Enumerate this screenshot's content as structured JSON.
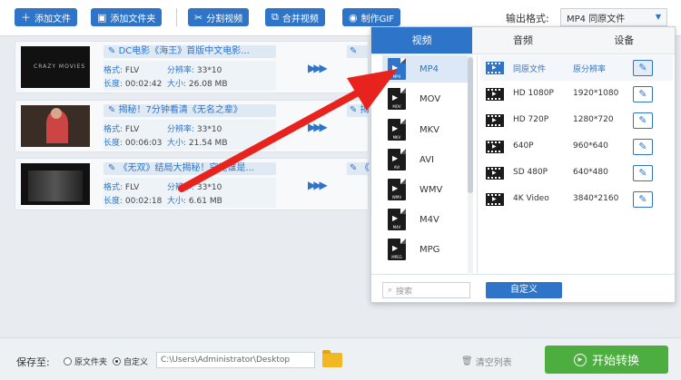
{
  "toolbar": {
    "add_file": "添加文件",
    "add_folder": "添加文件夹",
    "split_video": "分割视频",
    "merge_video": "合并视频",
    "make_gif": "制作GIF",
    "output_format_label": "输出格式:",
    "output_format_value": "MP4 同原文件"
  },
  "files": [
    {
      "title": "DC电影《海王》首版中文电影...",
      "format_label": "格式:",
      "format": "FLV",
      "resolution_label": "分辨率:",
      "resolution": "33*10",
      "duration_label": "长度:",
      "duration": "00:02:42",
      "size_label": "大小:",
      "size": "26.08 MB",
      "out_tag": "DC",
      "thumb_text": "CRAZY MOVIES"
    },
    {
      "title": "揭秘！7分钟看清《无名之辈》",
      "format_label": "格式:",
      "format": "FLV",
      "resolution_label": "分辨率:",
      "resolution": "33*10",
      "duration_label": "长度:",
      "duration": "00:06:03",
      "size_label": "大小:",
      "size": "21.54 MB",
      "out_tag": "揭"
    },
    {
      "title": "《无双》结局大揭秘！究竟谁是...",
      "format_label": "格式:",
      "format": "FLV",
      "resolution_label": "分辨率:",
      "resolution": "33*10",
      "duration_label": "长度:",
      "duration": "00:02:18",
      "size_label": "大小:",
      "size": "6.61 MB",
      "out_tag": "《"
    }
  ],
  "panel": {
    "tabs": [
      "视频",
      "音频",
      "设备"
    ],
    "active_tab": "视频",
    "formats": [
      {
        "name": "MP4",
        "selected": true
      },
      {
        "name": "MOV"
      },
      {
        "name": "MKV"
      },
      {
        "name": "AVI"
      },
      {
        "name": "WMV"
      },
      {
        "name": "M4V"
      },
      {
        "name": "MPG"
      }
    ],
    "resolutions": [
      {
        "name": "同原文件",
        "value": "原分辨率",
        "selected": true
      },
      {
        "name": "HD 1080P",
        "value": "1920*1080"
      },
      {
        "name": "HD 720P",
        "value": "1280*720"
      },
      {
        "name": "640P",
        "value": "960*640"
      },
      {
        "name": "SD 480P",
        "value": "640*480"
      },
      {
        "name": "4K Video",
        "value": "3840*2160"
      }
    ],
    "search_placeholder": "搜索",
    "custom_label": "自定义"
  },
  "bottom": {
    "save_to_label": "保存至:",
    "radio_original": "原文件夹",
    "radio_custom": "自定义",
    "path": "C:\\Users\\Administrator\\Desktop",
    "clear_list": "清空列表",
    "start_convert": "开始转换"
  },
  "colors": {
    "accent": "#2e74c9",
    "start_green": "#4cae3f",
    "arrow_red": "#e8221c"
  }
}
